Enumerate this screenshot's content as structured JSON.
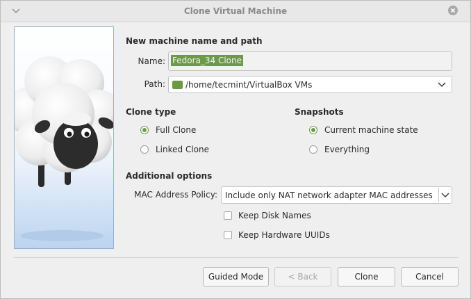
{
  "window": {
    "title": "Clone Virtual Machine"
  },
  "name_path": {
    "heading": "New machine name and path",
    "name_label": "Name:",
    "name_value": "Fedora_34 Clone",
    "path_label": "Path:",
    "path_value": "/home/tecmint/VirtualBox VMs"
  },
  "clone_type": {
    "heading": "Clone type",
    "options": [
      {
        "label": "Full Clone",
        "selected": true
      },
      {
        "label": "Linked Clone",
        "selected": false
      }
    ]
  },
  "snapshots": {
    "heading": "Snapshots",
    "options": [
      {
        "label": "Current machine state",
        "selected": true
      },
      {
        "label": "Everything",
        "selected": false
      }
    ]
  },
  "additional": {
    "heading": "Additional options",
    "mac_label": "MAC Address Policy:",
    "mac_value": "Include only NAT network adapter MAC addresses",
    "keep_disk_names": "Keep Disk Names",
    "keep_hardware_uuids": "Keep Hardware UUIDs"
  },
  "buttons": {
    "guided": "Guided Mode",
    "back": "< Back",
    "clone": "Clone",
    "cancel": "Cancel"
  },
  "colors": {
    "accent": "#6d9a4a",
    "panel_border": "#8fb3d4"
  }
}
